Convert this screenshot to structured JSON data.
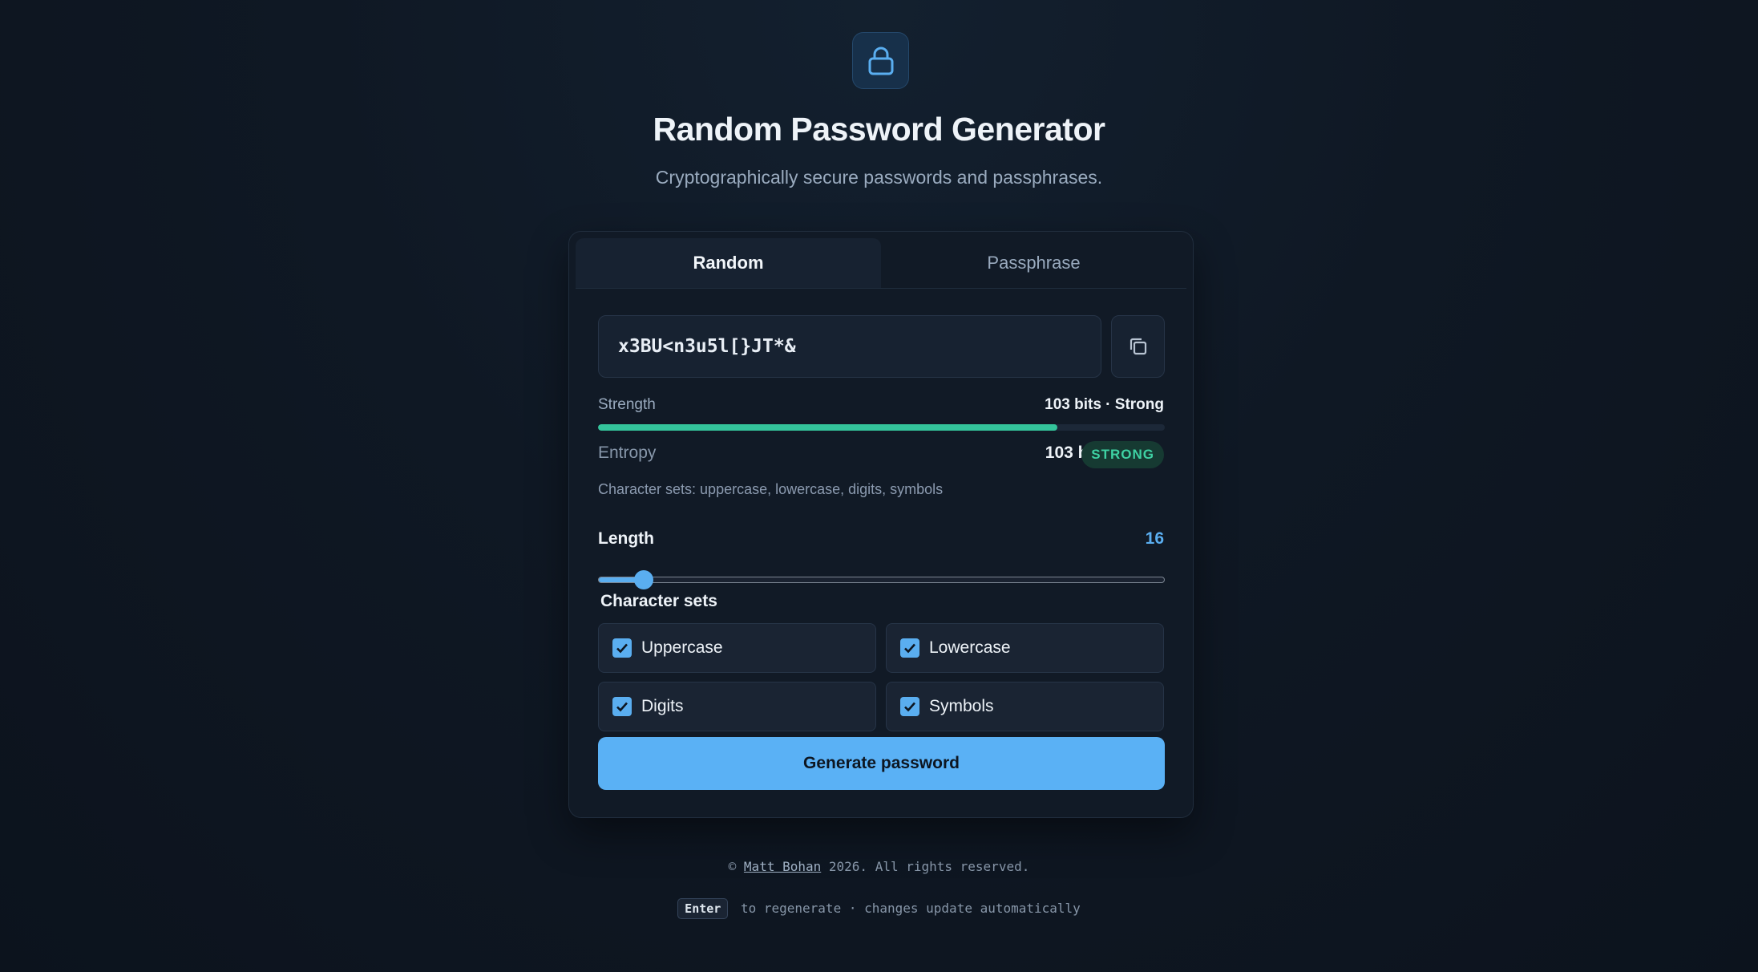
{
  "header": {
    "icon": "lock-icon",
    "title": "Random Password Generator",
    "subtitle": "Cryptographically secure passwords and passphrases."
  },
  "tabs": [
    {
      "label": "Random",
      "active": true
    },
    {
      "label": "Passphrase",
      "active": false
    }
  ],
  "password": {
    "value": "x3BU<n3u5l[}JT*&",
    "copy_icon": "copy-icon"
  },
  "strength": {
    "label": "Strength",
    "value": "103 bits · Strong",
    "fill_fraction": 0.81,
    "color": "#34c49b"
  },
  "entropy": {
    "label": "Entropy",
    "value": "103 bits",
    "badge": "STRONG"
  },
  "charsets_summary": "Character sets: uppercase, lowercase, digits, symbols",
  "length": {
    "label": "Length",
    "value": "16",
    "slider_fraction": 0.08
  },
  "charsets": {
    "heading": "Character sets",
    "options": [
      {
        "label": "Uppercase",
        "checked": true
      },
      {
        "label": "Lowercase",
        "checked": true
      },
      {
        "label": "Digits",
        "checked": true
      },
      {
        "label": "Symbols",
        "checked": true
      }
    ]
  },
  "generate_button": "Generate password",
  "footer": {
    "prefix": "©",
    "author": "Matt Bohan",
    "suffix": "2026. All rights reserved.",
    "hint_key": "Enter",
    "hint_text": "to regenerate · changes update automatically"
  },
  "colors": {
    "accent": "#5ab1f5",
    "strong": "#34c49b",
    "background": "#0f1824"
  }
}
